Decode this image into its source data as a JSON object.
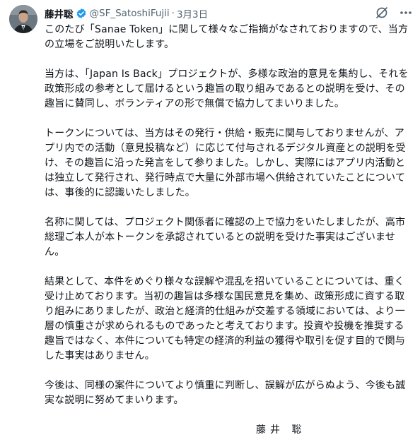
{
  "post": {
    "author_name": "藤井聡",
    "author_handle": "@SF_SatoshiFujii",
    "separator": "·",
    "date": "3月3日",
    "paragraphs": [
      "このたび「Sanae Token」に関して様々なご指摘がなされておりますので、当方の立場をご説明いたします。",
      "当方は、「Japan Is Back」プロジェクトが、多様な政治的意見を集約し、それを政策形成の参考として届けるという趣旨の取り組みであるとの説明を受け、その趣旨に賛同し、ボランティアの形で無償で協力してまいりました。",
      "トークンについては、当方はその発行・供給・販売に関与しておりませんが、アプリ内での活動（意見投稿など）に応じて付与されるデジタル資産との説明を受け、その趣旨に沿った発言をして参りました。しかし、実際にはアプリ内活動とは独立して発行され、発行時点で大量に外部市場へ供給されていたことについては、事後的に認識いたしました。",
      "名称に関しては、プロジェクト関係者に確認の上で協力をいたしましたが、高市総理ご本人が本トークンを承認されているとの説明を受けた事実はございません。",
      "結果として、本件をめぐり様々な誤解や混乱を招いていることについては、重く受け止めております。当初の趣旨は多様な国民意見を集め、政策形成に資する取り組みにありましたが、政治と経済的仕組みが交差する領域においては、より一層の慎重さが求められるものであったと考えております。投資や投機を推奨する趣旨ではなく、本件についても特定の経済的利益の獲得や取引を促す目的で関与した事実はありません。",
      "今後は、同様の案件についてより慎重に判断し、誤解が広がらぬよう、今後も誠実な説明に努めてまいります。"
    ],
    "signature": "藤井 聡"
  },
  "colors": {
    "verified": "#1d9bf0",
    "muted": "#536471",
    "text": "#0f1419"
  },
  "icons": [
    "verified-badge-icon",
    "grok-icon",
    "more-icon"
  ]
}
